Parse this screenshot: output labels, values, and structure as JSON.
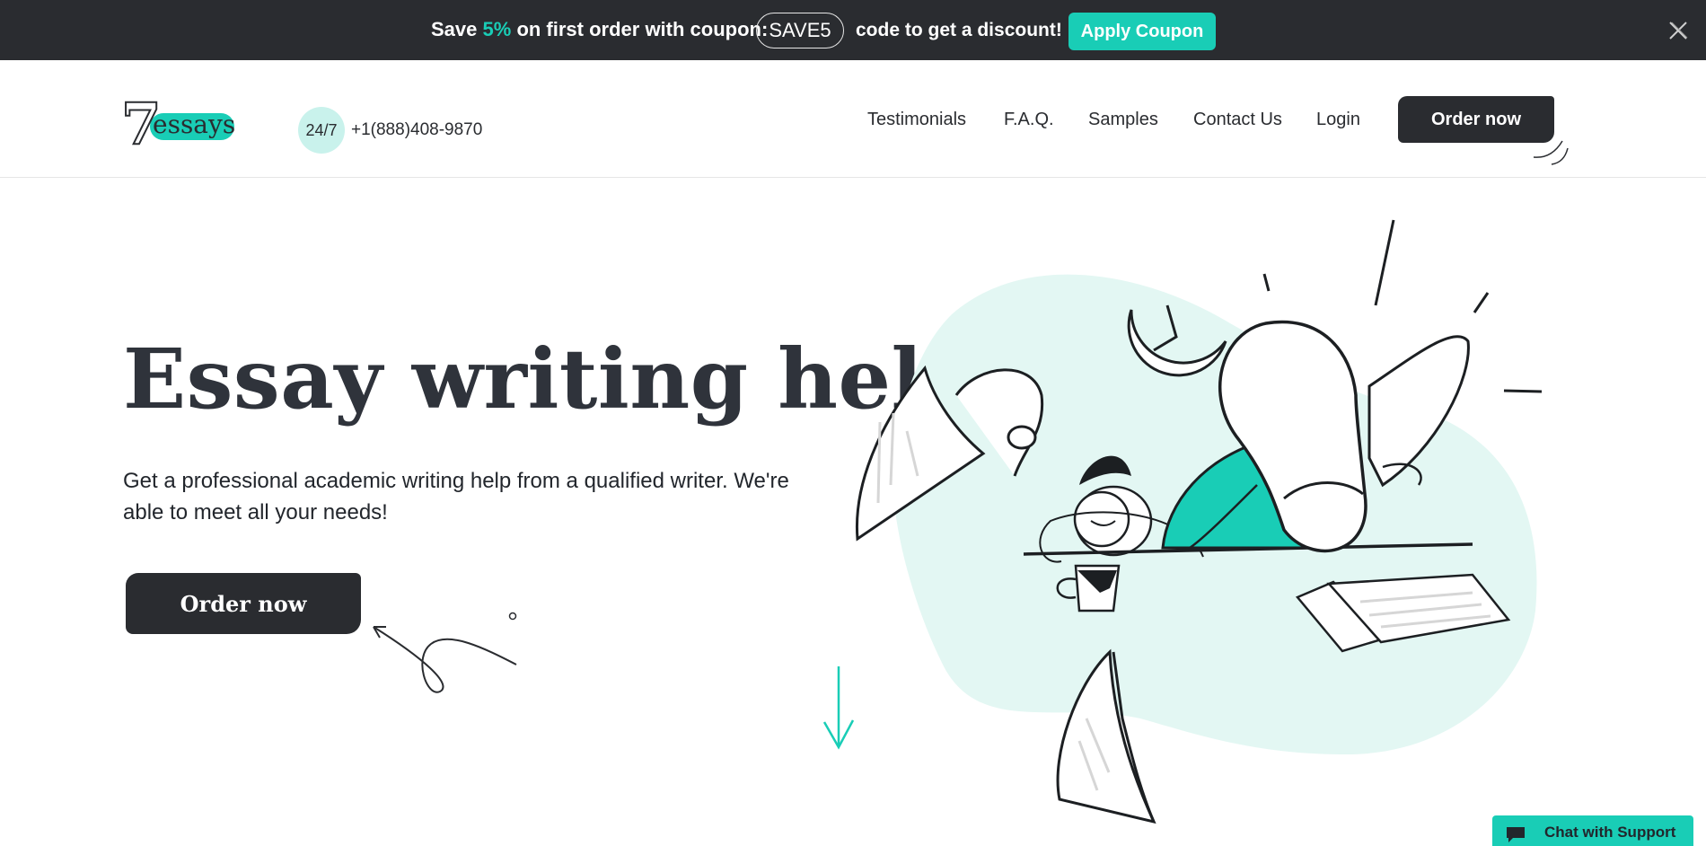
{
  "promo": {
    "save_prefix": "Save",
    "percent": "5%",
    "save_suffix": "on first order with coupon:",
    "coupon_code": "SAVE5",
    "after_code": "code to get a discount!",
    "apply_label": "Apply Coupon",
    "close_icon": "close-icon"
  },
  "header": {
    "logo_number": "7",
    "logo_word": "essays",
    "availability": "24/7",
    "phone": "+1(888)408-9870",
    "nav": [
      "Testimonials",
      "F.A.Q.",
      "Samples",
      "Contact Us",
      "Login"
    ],
    "order_label": "Order now"
  },
  "hero": {
    "title": "Essay writing help",
    "subtitle": "Get a professional academic writing help from a qualified writer. We're able to meet all your needs!",
    "order_label": "Order now"
  },
  "chat": {
    "label": "Chat with Support",
    "icon": "chat-bubble-icon"
  },
  "colors": {
    "accent": "#19cdb6",
    "dark": "#2a2c30",
    "mint_light": "#c9f2ec"
  }
}
